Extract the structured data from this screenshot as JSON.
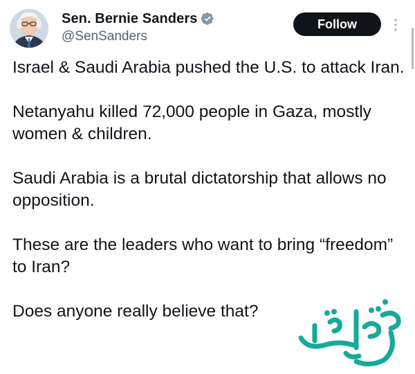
{
  "author": {
    "display_name": "Sen. Bernie Sanders",
    "handle": "@SenSanders",
    "verified_icon": "verified-badge-icon",
    "avatar_icon": "avatar"
  },
  "actions": {
    "follow_label": "Follow",
    "more_icon": "more-vertical-icon"
  },
  "tweet": {
    "paragraphs": [
      "Israel & Saudi Arabia pushed the U.S. to attack Iran.",
      "Netanyahu killed 72,000 people in Gaza, mostly women & children.",
      "Saudi Arabia is a brutal dictatorship that allows no opposition.",
      "These are the leaders who want to bring “freedom” to Iran?",
      "Does anyone really believe that?"
    ]
  },
  "watermark": {
    "text": "صفحه اقتصاد"
  },
  "colors": {
    "text": "#0f1419",
    "secondary_text": "#536471",
    "button_bg": "#0f1419",
    "verified_badge": "#829aab",
    "watermark": "#17a99a"
  }
}
